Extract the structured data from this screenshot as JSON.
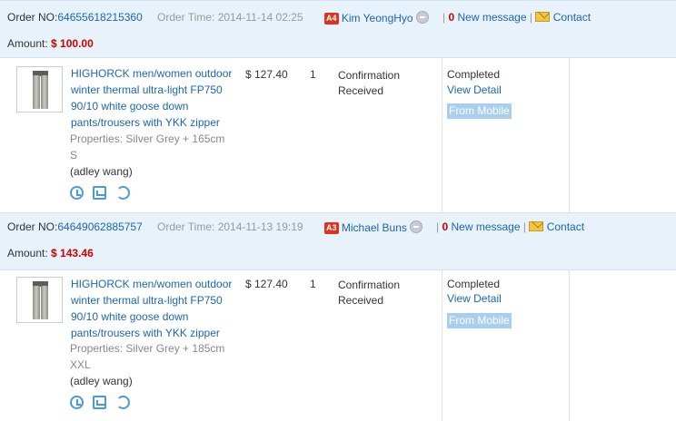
{
  "labels": {
    "order_no": "Order NO:",
    "order_time": "Order Time:",
    "amount": "Amount:",
    "contact": "Contact",
    "new_message_suffix": "New message",
    "properties": "Properties:",
    "view_detail": "View Detail",
    "from_mobile": "From Mobile",
    "separator": "|"
  },
  "orders": [
    {
      "order_no": "64655618215360",
      "order_time": "2014-11-14 02:25",
      "buyer_badge": "A4",
      "buyer_name": "Kim YeongHyo",
      "new_message_count": "0",
      "amount": "$ 100.00",
      "product_title": "HIGHORCK men/women outdoor winter thermal ultra-light FP750 90/10 white goose down pants/trousers with YKK zipper",
      "properties": "Silver Grey  + 165cm",
      "size": "S",
      "note": "(adley wang)",
      "price": "$ 127.40",
      "quantity": "1",
      "order_status": "Confirmation Received",
      "completion_status": "Completed"
    },
    {
      "order_no": "64649062885757",
      "order_time": "2014-11-13 19:19",
      "buyer_badge": "A3",
      "buyer_name": "Michael Buns",
      "new_message_count": "0",
      "amount": "$ 143.46",
      "product_title": "HIGHORCK men/women outdoor winter thermal ultra-light FP750 90/10 white goose down pants/trousers with YKK zipper",
      "properties": "Silver Grey  + 185cm",
      "size": "XXL",
      "note": "(adley wang)",
      "price": "$ 127.40",
      "quantity": "1",
      "order_status": "Confirmation Received",
      "completion_status": "Completed"
    }
  ],
  "icons": [
    "wangwang-icon",
    "envelope-icon",
    "clock-icon",
    "package-icon",
    "refresh-icon"
  ],
  "colors": {
    "link": "#1a66b3",
    "amount": "#cc0000",
    "header_bg": "#e8f2fb",
    "badge": "#e0301e",
    "from_mobile_bg": "#a8cff0"
  }
}
